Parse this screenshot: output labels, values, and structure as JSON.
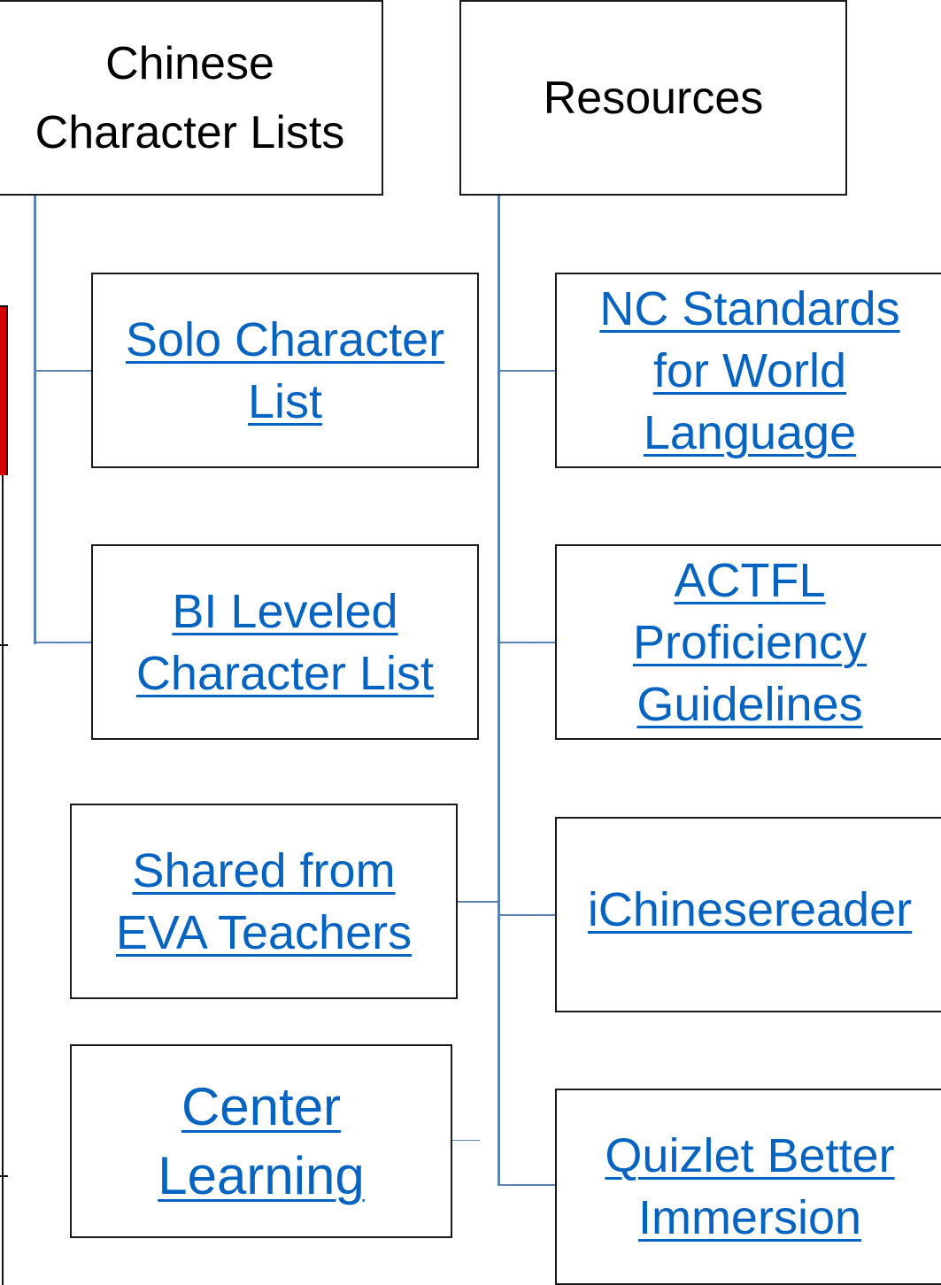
{
  "diagram": {
    "headers": {
      "chinese_character_lists": "Chinese\nCharacter Lists",
      "resources": "Resources"
    },
    "character_lists": {
      "solo": "Solo Character\nList",
      "bi_leveled": "BI Leveled\nCharacter List",
      "shared": "Shared from\nEVA Teachers",
      "center_learning": "Center\nLearning"
    },
    "resources": {
      "nc_standards": "NC Standards\nfor World\nLanguage",
      "actfl": "ACTFL\nProficiency\nGuidelines",
      "ichinesereader": "iChinesereader",
      "quizlet": "Quizlet Better\nImmersion"
    },
    "colors": {
      "link": "#0563C1",
      "connector": "#5B82B0",
      "border": "#1a1a1a",
      "edge_accent": "#d40000"
    }
  }
}
